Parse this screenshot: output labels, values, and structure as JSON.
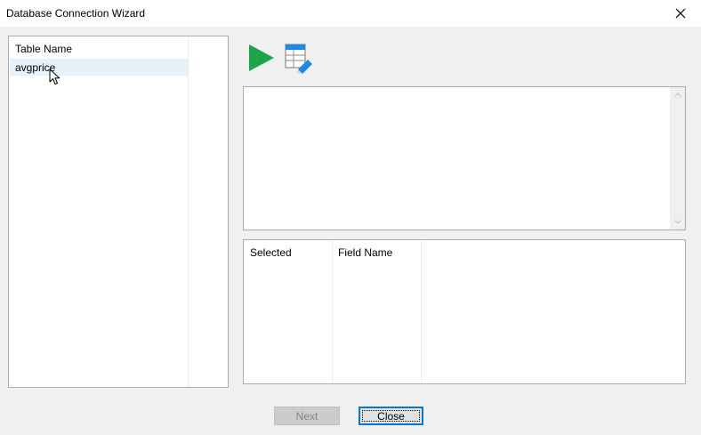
{
  "window": {
    "title": "Database Connection Wizard",
    "close_icon": "close-icon"
  },
  "tables": {
    "header": "Table Name",
    "items": [
      {
        "name": "avgprice",
        "selected": true
      }
    ]
  },
  "toolbar": {
    "run_icon": "play-icon",
    "table_icon": "table-edit-icon",
    "accent_green": "#1fa34a",
    "accent_blue": "#1e88e5"
  },
  "sql": {
    "value": ""
  },
  "fields": {
    "columns": [
      "Selected",
      "Field Name"
    ]
  },
  "buttons": {
    "next_label": "Next",
    "next_enabled": false,
    "close_label": "Close"
  }
}
